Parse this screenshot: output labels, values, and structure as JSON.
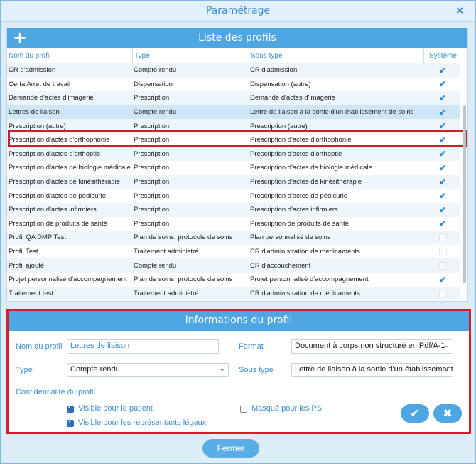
{
  "window": {
    "title": "Paramétrage",
    "close_glyph": "×",
    "close_label": "Fermer"
  },
  "profiles": {
    "panel_title": "Liste des profils",
    "add_glyph": "+",
    "columns": [
      "Nom du profil",
      "Type",
      "Sous type",
      "Système"
    ],
    "rows": [
      {
        "name": "CR d'admission",
        "type": "Compte rendu",
        "subtype": "CR d'admission",
        "system": true
      },
      {
        "name": "Cerfa Arret de travail",
        "type": "Dispensation",
        "subtype": "Dispensation (autre)",
        "system": true
      },
      {
        "name": "Demande d'actes d'imagerie",
        "type": "Prescription",
        "subtype": "Demande d'actes d'imagerie",
        "system": true
      },
      {
        "name": "Lettres de liaison",
        "type": "Compte rendu",
        "subtype": "Lettre de liaison à la sortie d'un établissement de soins",
        "system": true
      },
      {
        "name": "Prescription (autre)",
        "type": "Prescription",
        "subtype": "Prescription (autre)",
        "system": true
      },
      {
        "name": "Prescription d'actes d'orthophonie",
        "type": "Prescription",
        "subtype": "Prescription d'actes d'orthophonie",
        "system": true
      },
      {
        "name": "Prescription d'actes d'orthoptie",
        "type": "Prescription",
        "subtype": "Prescription d'actes d'orthoptie",
        "system": true
      },
      {
        "name": "Prescription d'actes de biologie médicale",
        "type": "Prescription",
        "subtype": "Prescription d'actes de biologie médicale",
        "system": true
      },
      {
        "name": "Prescription d'actes de kinésithérapie",
        "type": "Prescription",
        "subtype": "Prescription d'actes de kinésithérapie",
        "system": true
      },
      {
        "name": "Prescription d'actes de pédicurie",
        "type": "Prescription",
        "subtype": "Prescription d'actes de pédicurie",
        "system": true
      },
      {
        "name": "Prescription d'actes infirmiers",
        "type": "Prescription",
        "subtype": "Prescription d'actes infirmiers",
        "system": true
      },
      {
        "name": "Prescription de produits de santé",
        "type": "Prescription",
        "subtype": "Prescription de produits de santé",
        "system": true
      },
      {
        "name": "Profil QA DMP Test",
        "type": "Plan de soins, protocole de soins",
        "subtype": "Plan personnalisé de soins",
        "system": false
      },
      {
        "name": "Profil Test",
        "type": "Traitement administré",
        "subtype": "CR d'administration de médicaments",
        "system": false
      },
      {
        "name": "Profil ajouté",
        "type": "Compte rendu",
        "subtype": "CR d'accouchement",
        "system": false
      },
      {
        "name": "Projet personnalisé d'accompagnement",
        "type": "Plan de soins, protocole de soins",
        "subtype": "Projet personnalisé d'accompagnement",
        "system": true
      },
      {
        "name": "Traitement test",
        "type": "Traitement administré",
        "subtype": "CR d'administration de médicaments",
        "system": false
      }
    ],
    "selected_index": 3
  },
  "info": {
    "panel_title": "Informations du profil",
    "name_label": "Nom du profil",
    "name_value": "Lettres de liaison",
    "format_label": "Format",
    "format_value": "Document à corps non structuré en Pdf/A-1",
    "type_label": "Type",
    "type_value": "Compte rendu",
    "subtype_label": "Sous type",
    "subtype_value": "Lettre de liaison à la sortie d'un établissement de soins",
    "confid_label": "Confidentialité du profil",
    "visible_patient_label": "Visible pour le patient",
    "visible_patient_checked": true,
    "visible_legal_label": "Visible pour les représentants légaux",
    "visible_legal_checked": true,
    "hidden_ps_label": "Masqué pour les PS",
    "hidden_ps_checked": false,
    "confirm_glyph": "✔",
    "cancel_glyph": "✖"
  },
  "colors": {
    "accent": "#4ea6e2",
    "highlight_outline": "#d11f2a",
    "check": "#2d8bd6"
  },
  "icons": {
    "add": "plus-icon",
    "close": "close-icon",
    "confirm": "check-icon",
    "cancel": "cross-icon",
    "chevron": "chevron-down-icon"
  }
}
